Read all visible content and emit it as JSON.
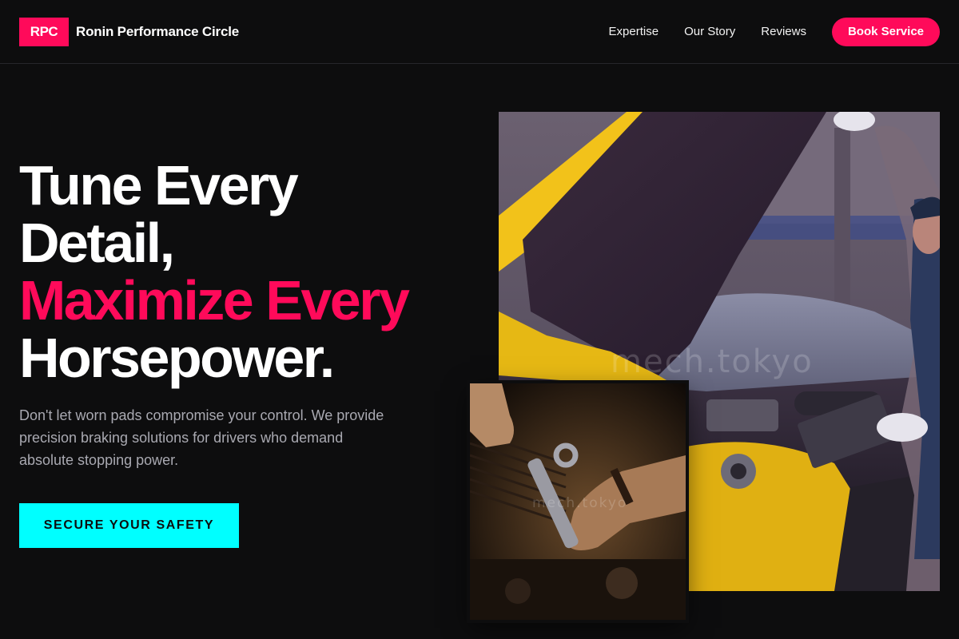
{
  "header": {
    "logo_text": "RPC",
    "brand_name": "Ronin Performance Circle",
    "nav": [
      {
        "label": "Expertise"
      },
      {
        "label": "Our Story"
      },
      {
        "label": "Reviews"
      }
    ],
    "cta_label": "Book Service"
  },
  "hero": {
    "title_line1": "Tune Every",
    "title_line2": "Detail,",
    "title_line3": "Maximize Every",
    "title_line4": "Horsepower.",
    "subtitle": "Don't let worn pads compromise your control. We provide precision braking solutions for drivers who demand absolute stopping power.",
    "cta_label": "SECURE YOUR SAFETY"
  },
  "images": {
    "main_watermark": "mech.tokyo",
    "secondary_watermark": "mech.tokyo"
  },
  "colors": {
    "background": "#0d0d0e",
    "accent_pink": "#ff0a5a",
    "accent_cyan": "#00ffff",
    "muted_text": "#a9a9b1"
  }
}
